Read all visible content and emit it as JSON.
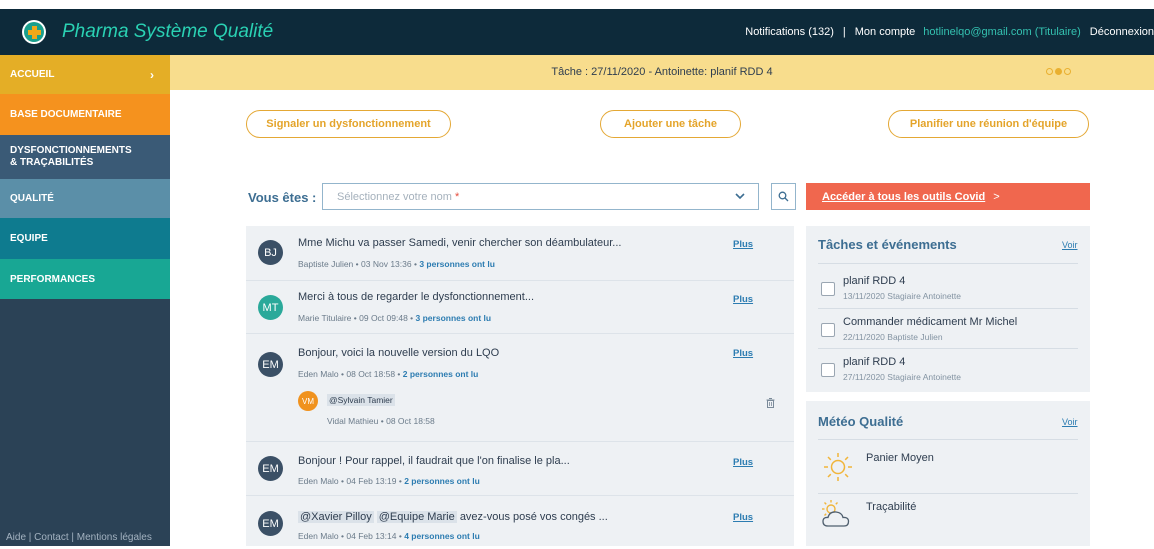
{
  "app": {
    "title": "Pharma Système Qualité"
  },
  "topbar": {
    "notifications": "Notifications (132)",
    "separator": "|",
    "account": "Mon compte",
    "email": "hotlinelqo@gmail.com (Titulaire)",
    "logout": "Déconnexion"
  },
  "sidebar": {
    "items": [
      {
        "label": "ACCUEIL",
        "color": "#e4ae26"
      },
      {
        "label": "BASE DOCUMENTAIRE",
        "color": "#f5921e"
      },
      {
        "label_line1": "DYSFONCTIONNEMENTS",
        "label_line2": "& TRAÇABILITÉS",
        "color": "#3a5a76"
      },
      {
        "label": "QUALITÉ",
        "color": "#5b8fa8"
      },
      {
        "label": "EQUIPE",
        "color": "#0e7b8f"
      },
      {
        "label": "PERFORMANCES",
        "color": "#18a794"
      }
    ],
    "footer": "Aide | Contact | Mentions légales"
  },
  "banner": {
    "task_text": "Tâche : 27/11/2020 - Antoinette: planif RDD 4",
    "slide_count": 3,
    "active_slide": 2
  },
  "actions": {
    "signal": "Signaler un dysfonctionnement",
    "add_task": "Ajouter une tâche",
    "plan_meeting": "Planifier une réunion d'équipe"
  },
  "identity": {
    "label": "Vous êtes :",
    "placeholder": "Sélectionnez votre nom",
    "required_mark": "*"
  },
  "covid": {
    "label": "Accéder à tous les outils Covid",
    "arrow": ">"
  },
  "feed": {
    "plus_label": "Plus",
    "messages": [
      {
        "initials": "BJ",
        "text": "Mme Michu va passer Samedi, venir chercher son déambulateur...",
        "author": "Baptiste Julien",
        "date": "03 Nov 13:36",
        "readers": "3 personnes ont lu"
      },
      {
        "initials": "MT",
        "text": "Merci à tous de regarder le dysfonctionnement...",
        "author": "Marie Titulaire",
        "date": "09 Oct 09:48",
        "readers": "3 personnes ont lu"
      },
      {
        "initials": "EM",
        "text": "Bonjour, voici la nouvelle version du LQO",
        "author": "Eden Malo",
        "date": "08 Oct 18:58",
        "readers": "2 personnes ont lu",
        "comment": {
          "initials": "VM",
          "text": "@Sylvain Tamier",
          "author": "Vidal Mathieu",
          "date": "08 Oct 18:58"
        }
      },
      {
        "initials": "EM",
        "text": "Bonjour ! Pour rappel, il faudrait que l'on finalise le pla...",
        "author": "Eden Malo",
        "date": "04 Feb 13:19",
        "readers": "2 personnes ont lu"
      },
      {
        "initials": "EM",
        "mention1": "@Xavier Pilloy",
        "mention2": "@Equipe Marie",
        "text": "avez-vous posé vos congés ...",
        "author": "Eden Malo",
        "date": "04 Feb 13:14",
        "readers": "4 personnes ont lu"
      }
    ],
    "meta_sep": "•"
  },
  "tasks_panel": {
    "title": "Tâches et événements",
    "voir": "Voir",
    "items": [
      {
        "title": "planif RDD 4",
        "sub": "13/11/2020 Stagiaire Antoinette"
      },
      {
        "title": "Commander médicament Mr Michel",
        "sub": "22/11/2020 Baptiste Julien"
      },
      {
        "title": "planif RDD 4",
        "sub": "27/11/2020 Stagiaire Antoinette"
      }
    ]
  },
  "meteo_panel": {
    "title": "Météo Qualité",
    "voir": "Voir",
    "items": [
      {
        "label": "Panier Moyen",
        "icon": "sun-icon"
      },
      {
        "label": "Traçabilité",
        "icon": "sun-cloud-icon"
      }
    ]
  },
  "colors": {
    "topbar": "#0d2a3a",
    "accent_teal": "#2ad1b3",
    "banner": "#f8dd8d",
    "covid": "#f0674e",
    "pill_border": "#e4a835"
  }
}
